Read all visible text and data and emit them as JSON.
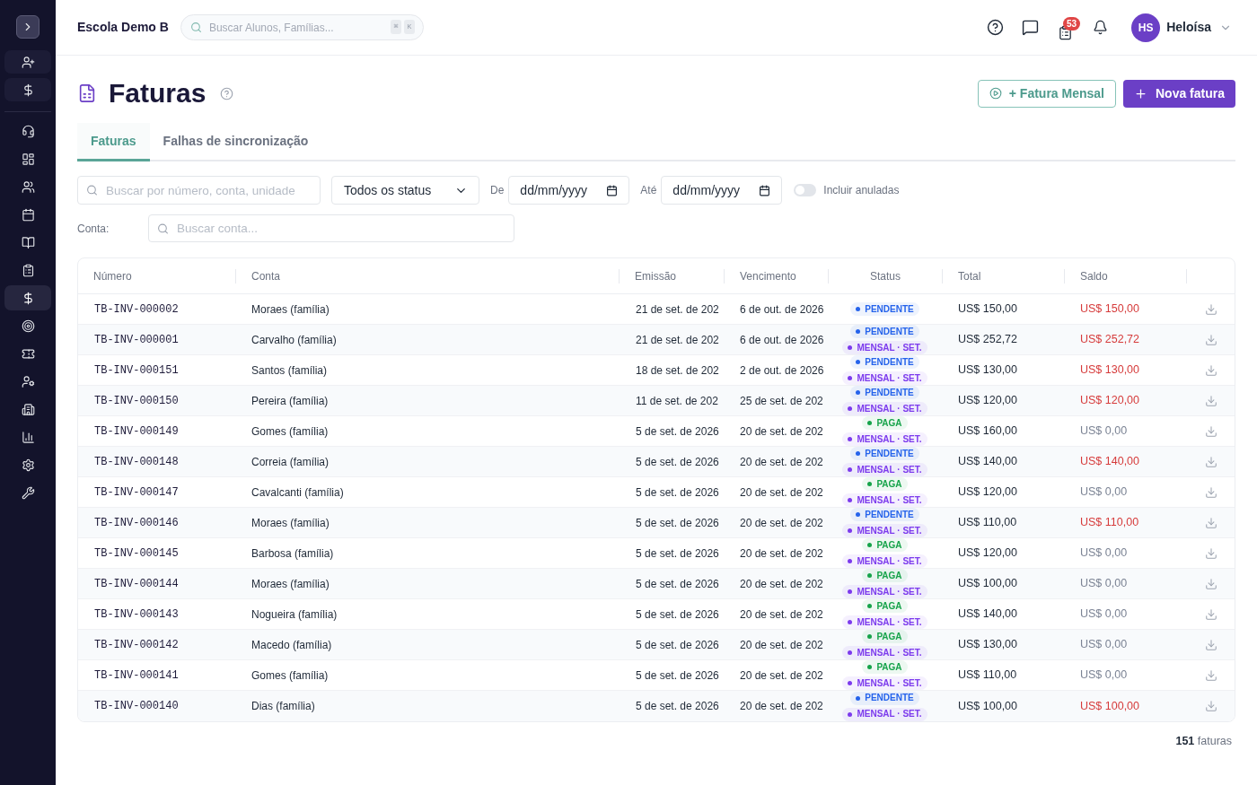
{
  "header": {
    "school": "Escola Demo B",
    "search": {
      "placeholder": "Buscar Alunos, Famílias...",
      "shortcut": [
        "⌘",
        "K"
      ]
    },
    "tasks_badge": "53",
    "user": {
      "initials": "HS",
      "name": "Heloísa"
    }
  },
  "sidebar": {
    "items": [
      {
        "selected": false
      },
      {
        "selected": false
      },
      {
        "selected": false
      },
      {
        "selected": false
      },
      {
        "selected": false
      },
      {
        "selected": false
      },
      {
        "selected": true
      },
      {
        "selected": false
      },
      {
        "selected": false
      },
      {
        "selected": false
      },
      {
        "selected": false
      },
      {
        "selected": false
      },
      {
        "selected": false
      },
      {
        "selected": false
      }
    ]
  },
  "page": {
    "title": "Faturas",
    "buttons": [
      {
        "kind": "outline",
        "label": "+ Fatura Mensal"
      },
      {
        "kind": "primary",
        "label": "Nova fatura"
      }
    ]
  },
  "tabs": [
    {
      "label": "Faturas",
      "selected": true
    },
    {
      "label": "Falhas de sincronização",
      "selected": false
    }
  ],
  "filters": {
    "search": {
      "placeholder": "Buscar por número, conta, unidade"
    },
    "status": {
      "value": "Todos os status"
    },
    "from": {
      "label": "De",
      "value": "dd/mm/yyyy"
    },
    "to": {
      "label": "Até",
      "value": "dd/mm/yyyy"
    },
    "include_voided": {
      "label": "Incluir anuladas",
      "on": false
    },
    "account": {
      "label": "Conta:",
      "placeholder": "Buscar conta..."
    }
  },
  "table": {
    "columns": [
      "Número",
      "Conta",
      "Emissão",
      "Vencimento",
      "Status",
      "Total",
      "Saldo"
    ],
    "rows": [
      {
        "number": "TB-INV-000002",
        "account": "Moraes (família)",
        "issued": "21 de set. de 202",
        "due": "6 de out. de 2026",
        "tags": [
          {
            "label": "PENDENTE",
            "color": "#2563eb"
          }
        ],
        "total": "US$ 150,00",
        "balance": "US$ 150,00",
        "balance_due": true
      },
      {
        "number": "TB-INV-000001",
        "account": "Carvalho (família)",
        "issued": "21 de set. de 202",
        "due": "6 de out. de 2026",
        "tags": [
          {
            "label": "PENDENTE",
            "color": "#2563eb"
          },
          {
            "label": "MENSAL · SET.",
            "color": "#7c3aed"
          }
        ],
        "total": "US$ 252,72",
        "balance": "US$ 252,72",
        "balance_due": true
      },
      {
        "number": "TB-INV-000151",
        "account": "Santos (família)",
        "issued": "18 de set. de 202",
        "due": "2 de out. de 2026",
        "tags": [
          {
            "label": "PENDENTE",
            "color": "#2563eb"
          },
          {
            "label": "MENSAL · SET.",
            "color": "#7c3aed"
          }
        ],
        "total": "US$ 130,00",
        "balance": "US$ 130,00",
        "balance_due": true
      },
      {
        "number": "TB-INV-000150",
        "account": "Pereira (família)",
        "issued": "11 de set. de 202",
        "due": "25 de set. de 202",
        "tags": [
          {
            "label": "PENDENTE",
            "color": "#2563eb"
          },
          {
            "label": "MENSAL · SET.",
            "color": "#7c3aed"
          }
        ],
        "total": "US$ 120,00",
        "balance": "US$ 120,00",
        "balance_due": true
      },
      {
        "number": "TB-INV-000149",
        "account": "Gomes (família)",
        "issued": "5 de set. de 2026",
        "due": "20 de set. de 202",
        "tags": [
          {
            "label": "PAGA",
            "color": "#16a34a"
          },
          {
            "label": "MENSAL · SET.",
            "color": "#7c3aed"
          }
        ],
        "total": "US$ 160,00",
        "balance": "US$ 0,00",
        "balance_due": false
      },
      {
        "number": "TB-INV-000148",
        "account": "Correia (família)",
        "issued": "5 de set. de 2026",
        "due": "20 de set. de 202",
        "tags": [
          {
            "label": "PENDENTE",
            "color": "#2563eb"
          },
          {
            "label": "MENSAL · SET.",
            "color": "#7c3aed"
          }
        ],
        "total": "US$ 140,00",
        "balance": "US$ 140,00",
        "balance_due": true
      },
      {
        "number": "TB-INV-000147",
        "account": "Cavalcanti (família)",
        "issued": "5 de set. de 2026",
        "due": "20 de set. de 202",
        "tags": [
          {
            "label": "PAGA",
            "color": "#16a34a"
          },
          {
            "label": "MENSAL · SET.",
            "color": "#7c3aed"
          }
        ],
        "total": "US$ 120,00",
        "balance": "US$ 0,00",
        "balance_due": false
      },
      {
        "number": "TB-INV-000146",
        "account": "Moraes (família)",
        "issued": "5 de set. de 2026",
        "due": "20 de set. de 202",
        "tags": [
          {
            "label": "PENDENTE",
            "color": "#2563eb"
          },
          {
            "label": "MENSAL · SET.",
            "color": "#7c3aed"
          }
        ],
        "total": "US$ 110,00",
        "balance": "US$ 110,00",
        "balance_due": true
      },
      {
        "number": "TB-INV-000145",
        "account": "Barbosa (família)",
        "issued": "5 de set. de 2026",
        "due": "20 de set. de 202",
        "tags": [
          {
            "label": "PAGA",
            "color": "#16a34a"
          },
          {
            "label": "MENSAL · SET.",
            "color": "#7c3aed"
          }
        ],
        "total": "US$ 120,00",
        "balance": "US$ 0,00",
        "balance_due": false
      },
      {
        "number": "TB-INV-000144",
        "account": "Moraes (família)",
        "issued": "5 de set. de 2026",
        "due": "20 de set. de 202",
        "tags": [
          {
            "label": "PAGA",
            "color": "#16a34a"
          },
          {
            "label": "MENSAL · SET.",
            "color": "#7c3aed"
          }
        ],
        "total": "US$ 100,00",
        "balance": "US$ 0,00",
        "balance_due": false
      },
      {
        "number": "TB-INV-000143",
        "account": "Nogueira (família)",
        "issued": "5 de set. de 2026",
        "due": "20 de set. de 202",
        "tags": [
          {
            "label": "PAGA",
            "color": "#16a34a"
          },
          {
            "label": "MENSAL · SET.",
            "color": "#7c3aed"
          }
        ],
        "total": "US$ 140,00",
        "balance": "US$ 0,00",
        "balance_due": false
      },
      {
        "number": "TB-INV-000142",
        "account": "Macedo (família)",
        "issued": "5 de set. de 2026",
        "due": "20 de set. de 202",
        "tags": [
          {
            "label": "PAGA",
            "color": "#16a34a"
          },
          {
            "label": "MENSAL · SET.",
            "color": "#7c3aed"
          }
        ],
        "total": "US$ 130,00",
        "balance": "US$ 0,00",
        "balance_due": false
      },
      {
        "number": "TB-INV-000141",
        "account": "Gomes (família)",
        "issued": "5 de set. de 2026",
        "due": "20 de set. de 202",
        "tags": [
          {
            "label": "PAGA",
            "color": "#16a34a"
          },
          {
            "label": "MENSAL · SET.",
            "color": "#7c3aed"
          }
        ],
        "total": "US$ 110,00",
        "balance": "US$ 0,00",
        "balance_due": false
      },
      {
        "number": "TB-INV-000140",
        "account": "Dias (família)",
        "issued": "5 de set. de 2026",
        "due": "20 de set. de 202",
        "tags": [
          {
            "label": "PENDENTE",
            "color": "#2563eb"
          },
          {
            "label": "MENSAL · SET.",
            "color": "#7c3aed"
          }
        ],
        "total": "US$ 100,00",
        "balance": "US$ 100,00",
        "balance_due": true
      }
    ]
  },
  "footer": {
    "count": "**151** faturas"
  }
}
